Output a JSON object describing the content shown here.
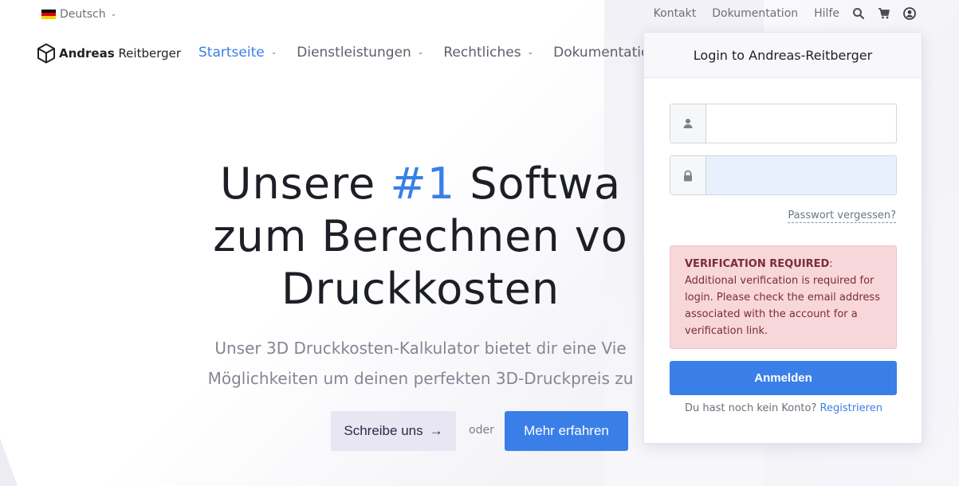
{
  "topbar": {
    "language": "Deutsch",
    "links": [
      "Kontakt",
      "Dokumentation",
      "Hilfe"
    ],
    "icons": [
      "search-icon",
      "cart-icon",
      "user-icon"
    ]
  },
  "brand": {
    "name_bold": "Andreas",
    "name_regular": "Reitberger"
  },
  "nav": {
    "items": [
      {
        "label": "Startseite",
        "active": true,
        "has_dropdown": true
      },
      {
        "label": "Dienstleistungen",
        "active": false,
        "has_dropdown": true
      },
      {
        "label": "Rechtliches",
        "active": false,
        "has_dropdown": true
      },
      {
        "label": "Dokumentation",
        "active": false,
        "has_dropdown": false
      }
    ]
  },
  "hero": {
    "title_part1": "Unsere ",
    "title_accent": "#1",
    "title_part2": " Softwa",
    "title_line2": "zum Berechnen vo",
    "title_line3": "Druckkosten",
    "subtitle_line1": "Unser 3D Druckkosten-Kalkulator bietet dir eine Vie",
    "subtitle_line2": "Möglichkeiten um deinen perfekten 3D-Druckpreis zu",
    "contact_button": "Schreibe uns",
    "separator": "oder",
    "learn_more_button": "Mehr erfahren"
  },
  "login": {
    "title": "Login to Andreas-Reitberger",
    "username_value": "",
    "password_value": "",
    "forgot_password": "Passwort vergessen?",
    "alert_title": "VERIFICATION REQUIRED",
    "alert_text": "Additional verification is required for login. Please check the email address associated with the account for a verification link.",
    "submit_button": "Anmelden",
    "no_account_text": "Du hast noch kein Konto?",
    "register_link": "Registrieren"
  },
  "colors": {
    "accent": "#3a7fe8",
    "alert_bg": "#f8d7da",
    "alert_text": "#7a2d35"
  }
}
